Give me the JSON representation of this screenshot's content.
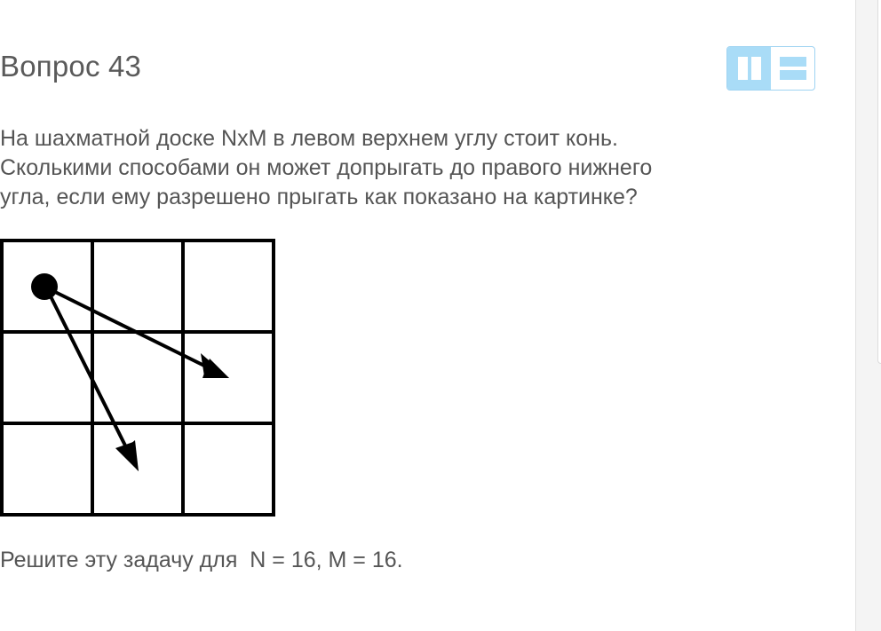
{
  "question": {
    "title": "Вопрос 43",
    "text_lines": [
      "На шахматной доске NxM в левом верхнем углу стоит конь.",
      "Сколькими способами он может допрыгать до правого нижнего",
      "угла, если ему разрешено прыгать как показано на картинке?"
    ],
    "task": "Решите эту задачу для  N = 16, M = 16."
  },
  "layout_toggle": {
    "options": [
      {
        "name": "two-column-layout-icon",
        "active": true
      },
      {
        "name": "stacked-layout-icon",
        "active": false
      }
    ],
    "accent_color": "#a9dcf7"
  },
  "figure": {
    "grid_rows": 3,
    "grid_cols": 3,
    "knight_cell": [
      0,
      0
    ],
    "moves": [
      {
        "to_cell": [
          1,
          2
        ]
      },
      {
        "to_cell": [
          2,
          1
        ]
      }
    ]
  }
}
